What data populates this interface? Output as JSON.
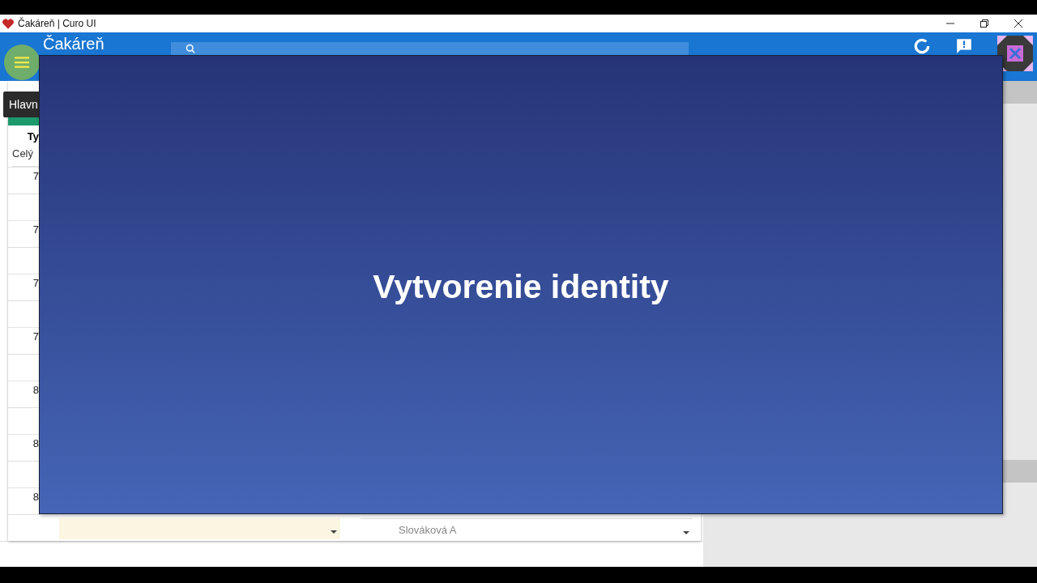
{
  "window": {
    "title": "Čakáreň | Curo UI"
  },
  "header": {
    "title": "Čakáreň"
  },
  "tooltip": {
    "text": "Hlavn"
  },
  "table": {
    "column_1": "Ty",
    "filter": "Celý",
    "rows": [
      {
        "time": "7"
      },
      {
        "time": "7"
      },
      {
        "time": "7"
      },
      {
        "time": "7"
      },
      {
        "time": "8"
      },
      {
        "time": "8"
      },
      {
        "time": "8"
      }
    ]
  },
  "bottom_fields": {
    "doctor": "Slováková A"
  },
  "dialog": {
    "title": "Vytvorenie identity"
  }
}
